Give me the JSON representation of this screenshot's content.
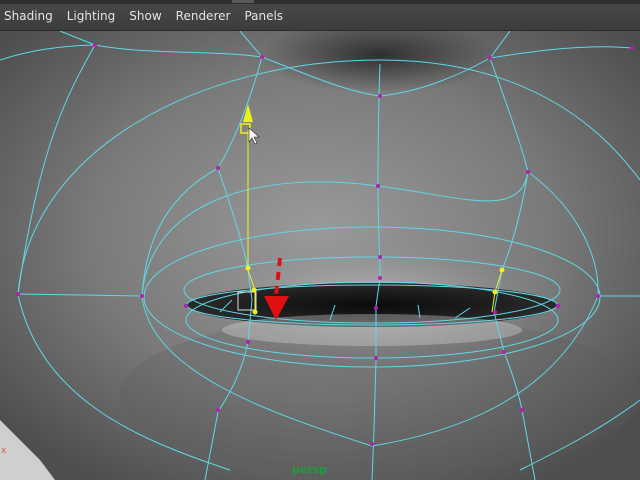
{
  "menu": {
    "items": [
      {
        "key": "shading",
        "label": "Shading"
      },
      {
        "key": "lighting",
        "label": "Lighting"
      },
      {
        "key": "show",
        "label": "Show"
      },
      {
        "key": "renderer",
        "label": "Renderer"
      },
      {
        "key": "panels",
        "label": "Panels"
      }
    ]
  },
  "viewport": {
    "camera_label": "persp",
    "axis_label": "x"
  },
  "colors": {
    "wireframe": "#5fd8e6",
    "vertex": "#b020b0",
    "selected": "#f0f020",
    "arrow": "#e01010"
  },
  "icons": {
    "cursor": "mouse-pointer-icon",
    "manipulator": "move-manipulator-icon",
    "arrow": "red-down-arrow-icon"
  }
}
